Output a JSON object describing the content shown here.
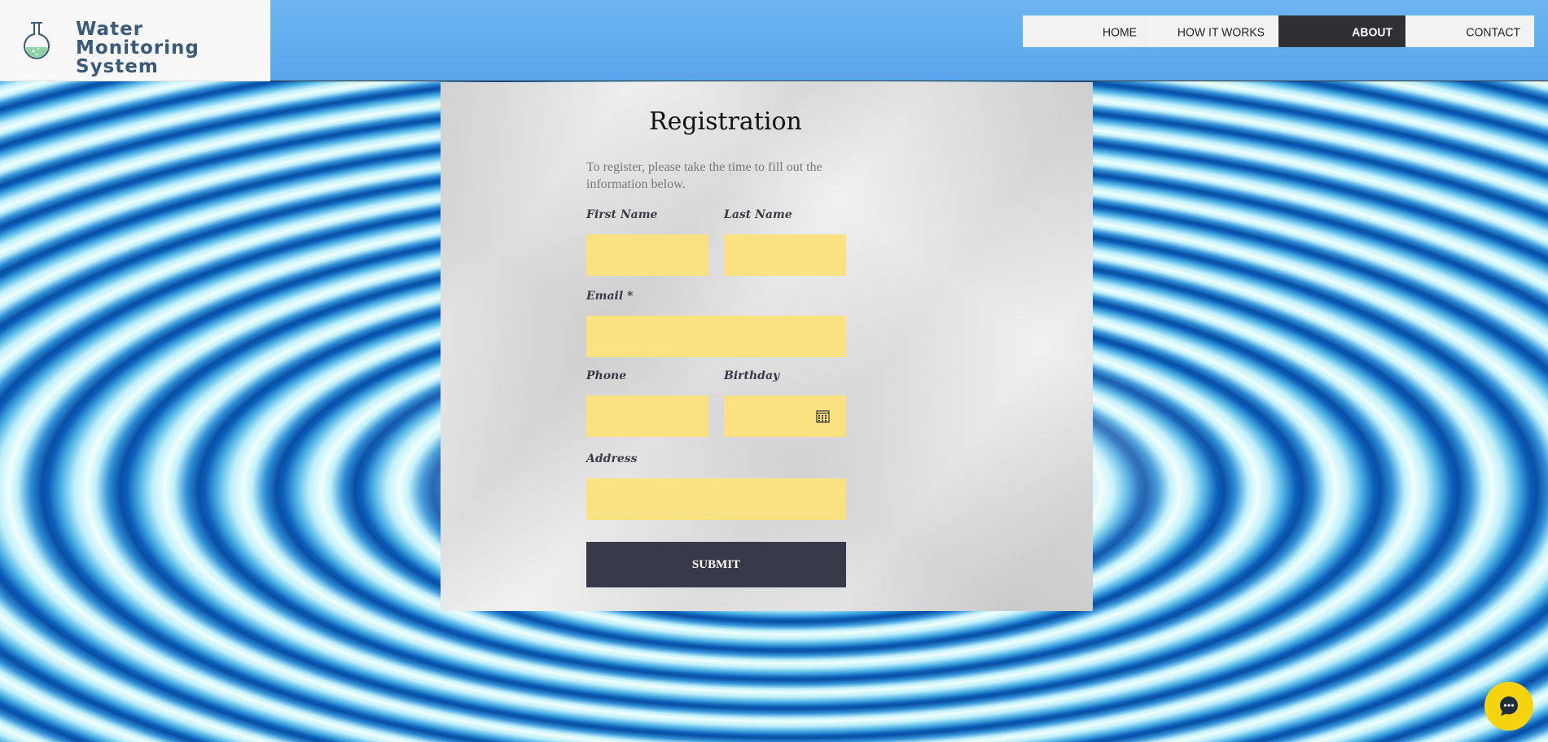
{
  "header": {
    "site_title": "Water Monitoring System",
    "nav": [
      {
        "label": "HOME"
      },
      {
        "label": "HOW IT WORKS"
      },
      {
        "label": "ABOUT",
        "active": true
      },
      {
        "label": "CONTACT"
      }
    ]
  },
  "form": {
    "title": "Registration",
    "intro": "To register, please take the time to fill out the information below.",
    "fields": {
      "first_name": {
        "label": "First Name",
        "value": ""
      },
      "last_name": {
        "label": "Last Name",
        "value": ""
      },
      "email": {
        "label": "Email *",
        "value": ""
      },
      "phone": {
        "label": "Phone",
        "value": ""
      },
      "birthday": {
        "label": "Birthday",
        "value": ""
      },
      "address": {
        "label": "Address",
        "value": ""
      }
    },
    "submit_label": "SUBMIT"
  },
  "colors": {
    "field_bg": "#fae282",
    "submit_bg": "#383a4b",
    "nav_active_bg": "#2f3033",
    "header_bg": "#6db5f1",
    "chat_button": "#f5d40f"
  },
  "icons": {
    "logo": "flask-icon",
    "birthday": "calendar-icon",
    "chat": "chat-bubble-icon"
  }
}
